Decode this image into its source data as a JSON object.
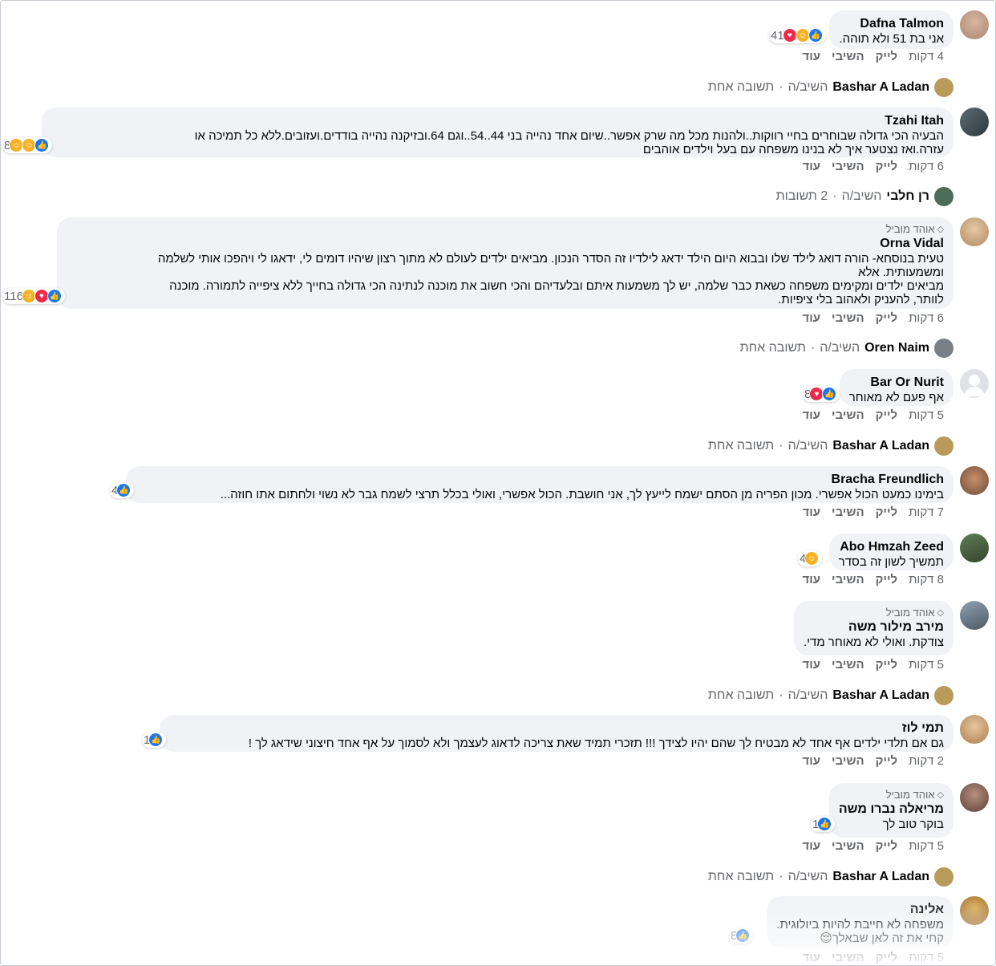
{
  "comments": [
    {
      "author": "Dafna Talmon",
      "text": [
        "אני בת 51 ולא תוהה."
      ],
      "react_count": "41",
      "reactions": [
        "like",
        "haha",
        "love"
      ],
      "time": "4 דקות",
      "like": "לייק",
      "reply": "השיבי",
      "more": "עוד",
      "replies": {
        "name": "Bashar A Ladan",
        "verb": "השיב/ה",
        "sep": "·",
        "count": "תשובה אחת"
      }
    },
    {
      "author": "Tzahi Itah",
      "text": [
        "הבעיה הכי גדולה שבוחרים בחיי רווקות..ולהנות מכל מה שרק אפשר..שיום אחד נהייה בני 44..54..וגם 64.ובזיקנה נהייה בודדים.ועזובים.ללא כל תמיכה או",
        "עזרה.ואז נצטער איך לא בנינו משפחה עם בעל וילדים אוהבים"
      ],
      "react_count": "8",
      "reactions": [
        "like",
        "haha",
        "care"
      ],
      "time": "6 דקות",
      "like": "לייק",
      "reply": "השיבי",
      "more": "עוד",
      "replies": {
        "name": "רן חלבי",
        "verb": "השיב/ה",
        "sep": "·",
        "count": "2 תשובות"
      }
    },
    {
      "badge": "אוהד מוביל",
      "author": "Orna Vidal",
      "text": [
        "טעית בנוסחא- הורה דואג לילד שלו ובבוא היום הילד ידאג לילדיו זה הסדר הנכון. מביאים ילדים לעולם לא מתוך רצון שיהיו דומים לי, ידאגו לי ויהפכו אותי לשלמה",
        "ומשמעותית. אלא",
        "מביאים ילדים ומקימים משפחה כשאת כבר שלמה, יש לך משמעות איתם ובלעדיהם והכי חשוב את מוכנה לנתינה הכי גדולה בחייך ללא ציפייה לתמורה. מוכנה",
        "לוותר, להעניק ולאהוב בלי ציפיות."
      ],
      "react_count": "116",
      "reactions": [
        "like",
        "love",
        "care"
      ],
      "time": "6 דקות",
      "like": "לייק",
      "reply": "השיבי",
      "more": "עוד",
      "replies": {
        "name": "Oren Naim",
        "verb": "השיב/ה",
        "sep": "·",
        "count": "תשובה אחת"
      }
    },
    {
      "author": "Bar Or Nurit",
      "text": [
        "אף פעם לא מאוחר"
      ],
      "react_count": "8",
      "reactions": [
        "like",
        "love"
      ],
      "time": "5 דקות",
      "like": "לייק",
      "reply": "השיבי",
      "more": "עוד",
      "replies": {
        "name": "Bashar A Ladan",
        "verb": "השיב/ה",
        "sep": "·",
        "count": "תשובה אחת"
      }
    },
    {
      "author": "Bracha Freundlich",
      "text": [
        "בימינו כמעט הכול אפשרי. מכון הפריה מן הסתם ישמח לייעץ לך, אני חושבת. הכול אפשרי, ואולי בכלל תרצי לשמח גבר לא נשוי ולחתום אתו חוזה..."
      ],
      "react_count": "4",
      "reactions": [
        "like"
      ],
      "time": "7 דקות",
      "like": "לייק",
      "reply": "השיבי",
      "more": "עוד"
    },
    {
      "author": "Abo Hmzah Zeed",
      "text": [
        "תמשיך לשון זה בסדר"
      ],
      "react_count": "4",
      "reactions": [
        "haha"
      ],
      "time": "8 דקות",
      "like": "לייק",
      "reply": "השיבי",
      "more": "עוד"
    },
    {
      "badge": "אוהד מוביל",
      "author": "מירב מילור משה",
      "text": [
        "צודקת. ואולי לא מאוחר מדי."
      ],
      "time": "5 דקות",
      "like": "לייק",
      "reply": "השיבי",
      "more": "עוד",
      "replies": {
        "name": "Bashar A Ladan",
        "verb": "השיב/ה",
        "sep": "·",
        "count": "תשובה אחת"
      }
    },
    {
      "author": "תמי לוז",
      "text": [
        "גם אם תלדי ילדים אף אחד לא מבטיח לך שהם יהיו לצידך !!! תזכרי תמיד שאת צריכה לדאוג לעצמך ולא לסמוך על אף אחד חיצוני שידאג לך !"
      ],
      "react_count": "1",
      "reactions": [
        "like"
      ],
      "time": "2 דקות",
      "like": "לייק",
      "reply": "השיבי",
      "more": "עוד"
    },
    {
      "badge": "אוהד מוביל",
      "author": "מריאלה נברו משה",
      "text": [
        "בוקר טוב לך"
      ],
      "react_count": "1",
      "reactions": [
        "like"
      ],
      "time": "5 דקות",
      "like": "לייק",
      "reply": "השיבי",
      "more": "עוד",
      "replies": {
        "name": "Bashar A Ladan",
        "verb": "השיב/ה",
        "sep": "·",
        "count": "תשובה אחת"
      }
    },
    {
      "author": "אלינה",
      "text": [
        "משפחה לא חייבת להיות ביולוגית.",
        "קחי את זה לאן שבאלך😌"
      ],
      "react_count": "8",
      "reactions": [
        "like"
      ],
      "time": "5 דקות",
      "like": "לייק",
      "reply": "השיבי",
      "more": "עוד"
    }
  ],
  "colors": {
    "bubble": "#f0f2f5",
    "like": "#1877f2",
    "love": "#f02849",
    "haha": "#f7b125",
    "muted": "#65676b"
  }
}
